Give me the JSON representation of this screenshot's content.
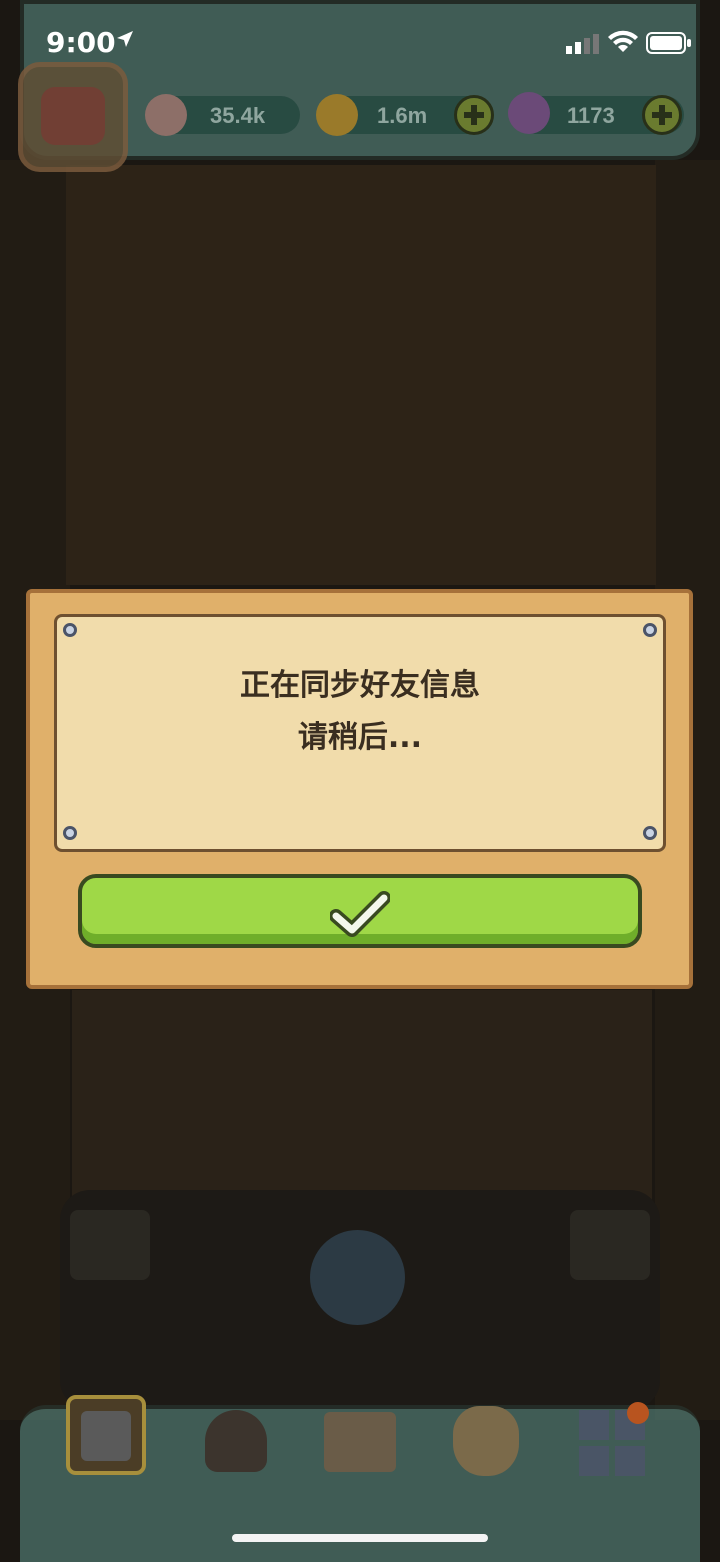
{
  "status_bar": {
    "time": "9:00"
  },
  "resources": {
    "eyeballs": "35.4k",
    "coins": "1.6m",
    "potions": "1173"
  },
  "dialog": {
    "line1": "正在同步好友信息",
    "line2": "请稍后..."
  },
  "colors": {
    "dialog_wood": "#e0b06a",
    "paper": "#f1dcab",
    "confirm_green": "#9fd847",
    "hud_teal": "#5f958c"
  }
}
